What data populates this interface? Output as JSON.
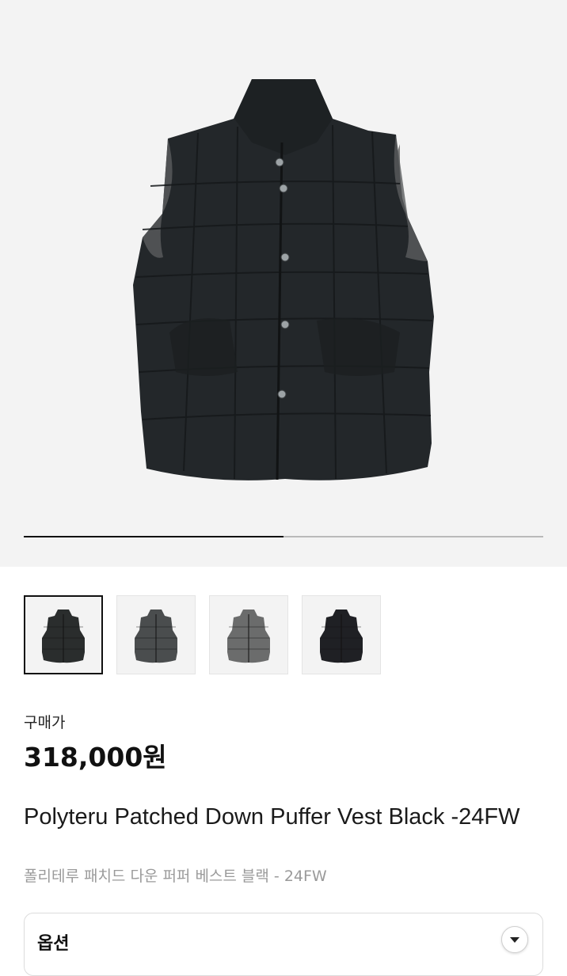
{
  "gallery": {
    "progress_fraction": 0.5,
    "thumbnails": [
      {
        "name": "thumb-black",
        "color": "#2a2d2d",
        "selected": true
      },
      {
        "name": "thumb-charcoal",
        "color": "#4a4d4e",
        "selected": false
      },
      {
        "name": "thumb-grey",
        "color": "#6b6c6c",
        "selected": false
      },
      {
        "name": "thumb-navy-black",
        "color": "#1f2024",
        "selected": false
      }
    ],
    "product_color": "#23272a",
    "lining_color": "#7d7d7d"
  },
  "price": {
    "label": "구매가",
    "value": "318,000원"
  },
  "product": {
    "title_en": "Polyteru Patched Down Puffer Vest Black -24FW",
    "title_ko": "폴리테루 패치드 다운 퍼퍼 베스트 블랙 - 24FW"
  },
  "option": {
    "label": "옵션",
    "icon": "chevron-down-icon"
  }
}
